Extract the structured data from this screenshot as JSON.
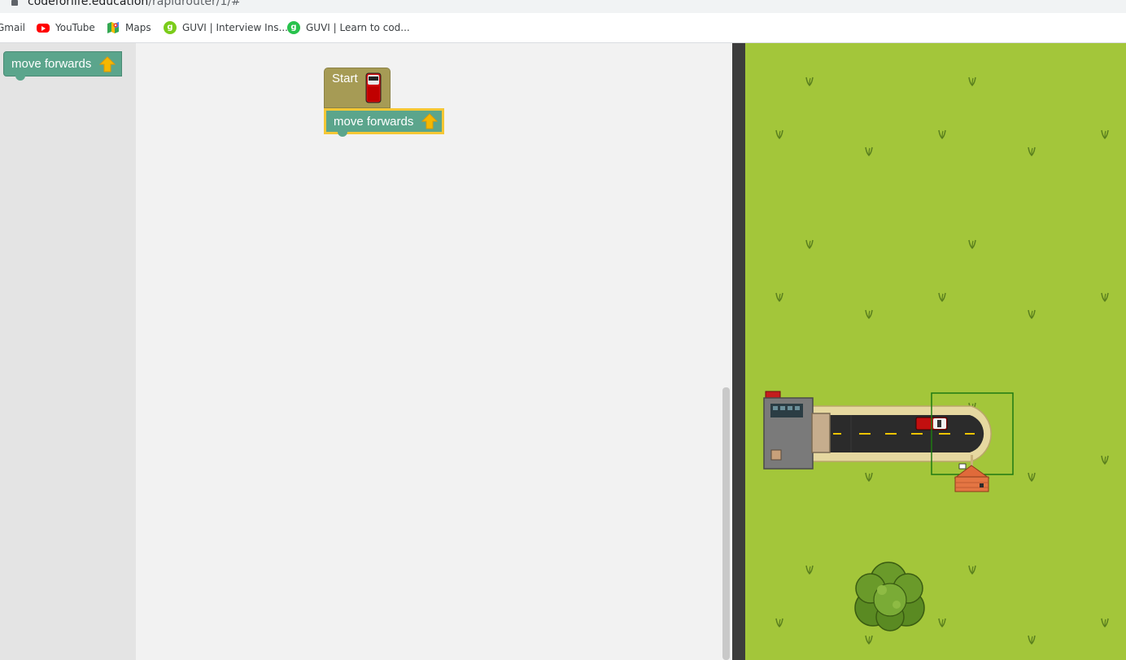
{
  "browser": {
    "url_host": "codeforlife.education",
    "url_path": "/rapidrouter/1/#",
    "bookmarks": [
      {
        "label": "Gmail",
        "icon": "gmail-icon"
      },
      {
        "label": "YouTube",
        "icon": "youtube-icon"
      },
      {
        "label": "Maps",
        "icon": "maps-icon"
      },
      {
        "label": "GUVI | Interview Ins...",
        "icon": "guvi-icon"
      },
      {
        "label": "GUVI | Learn to cod...",
        "icon": "guvi-icon"
      }
    ]
  },
  "toolbox": {
    "blocks": [
      {
        "label": "move forwards",
        "icon": "arrow-up-icon"
      }
    ]
  },
  "workspace": {
    "start_block": {
      "label": "Start",
      "icon": "car-icon"
    },
    "program": [
      {
        "label": "move forwards",
        "icon": "arrow-up-icon",
        "selected": true
      }
    ]
  },
  "map": {
    "scene": [
      "house-icon",
      "road",
      "van-icon",
      "destination-house-icon",
      "tree-icon",
      "grass-icon"
    ]
  },
  "colors": {
    "move_block": "#5ba58c",
    "start_block": "#a69b55",
    "selection_outline": "#f5c735",
    "grass": "#a3c63a",
    "road": "#2b2b2b",
    "lane_marking": "#f0c400"
  }
}
